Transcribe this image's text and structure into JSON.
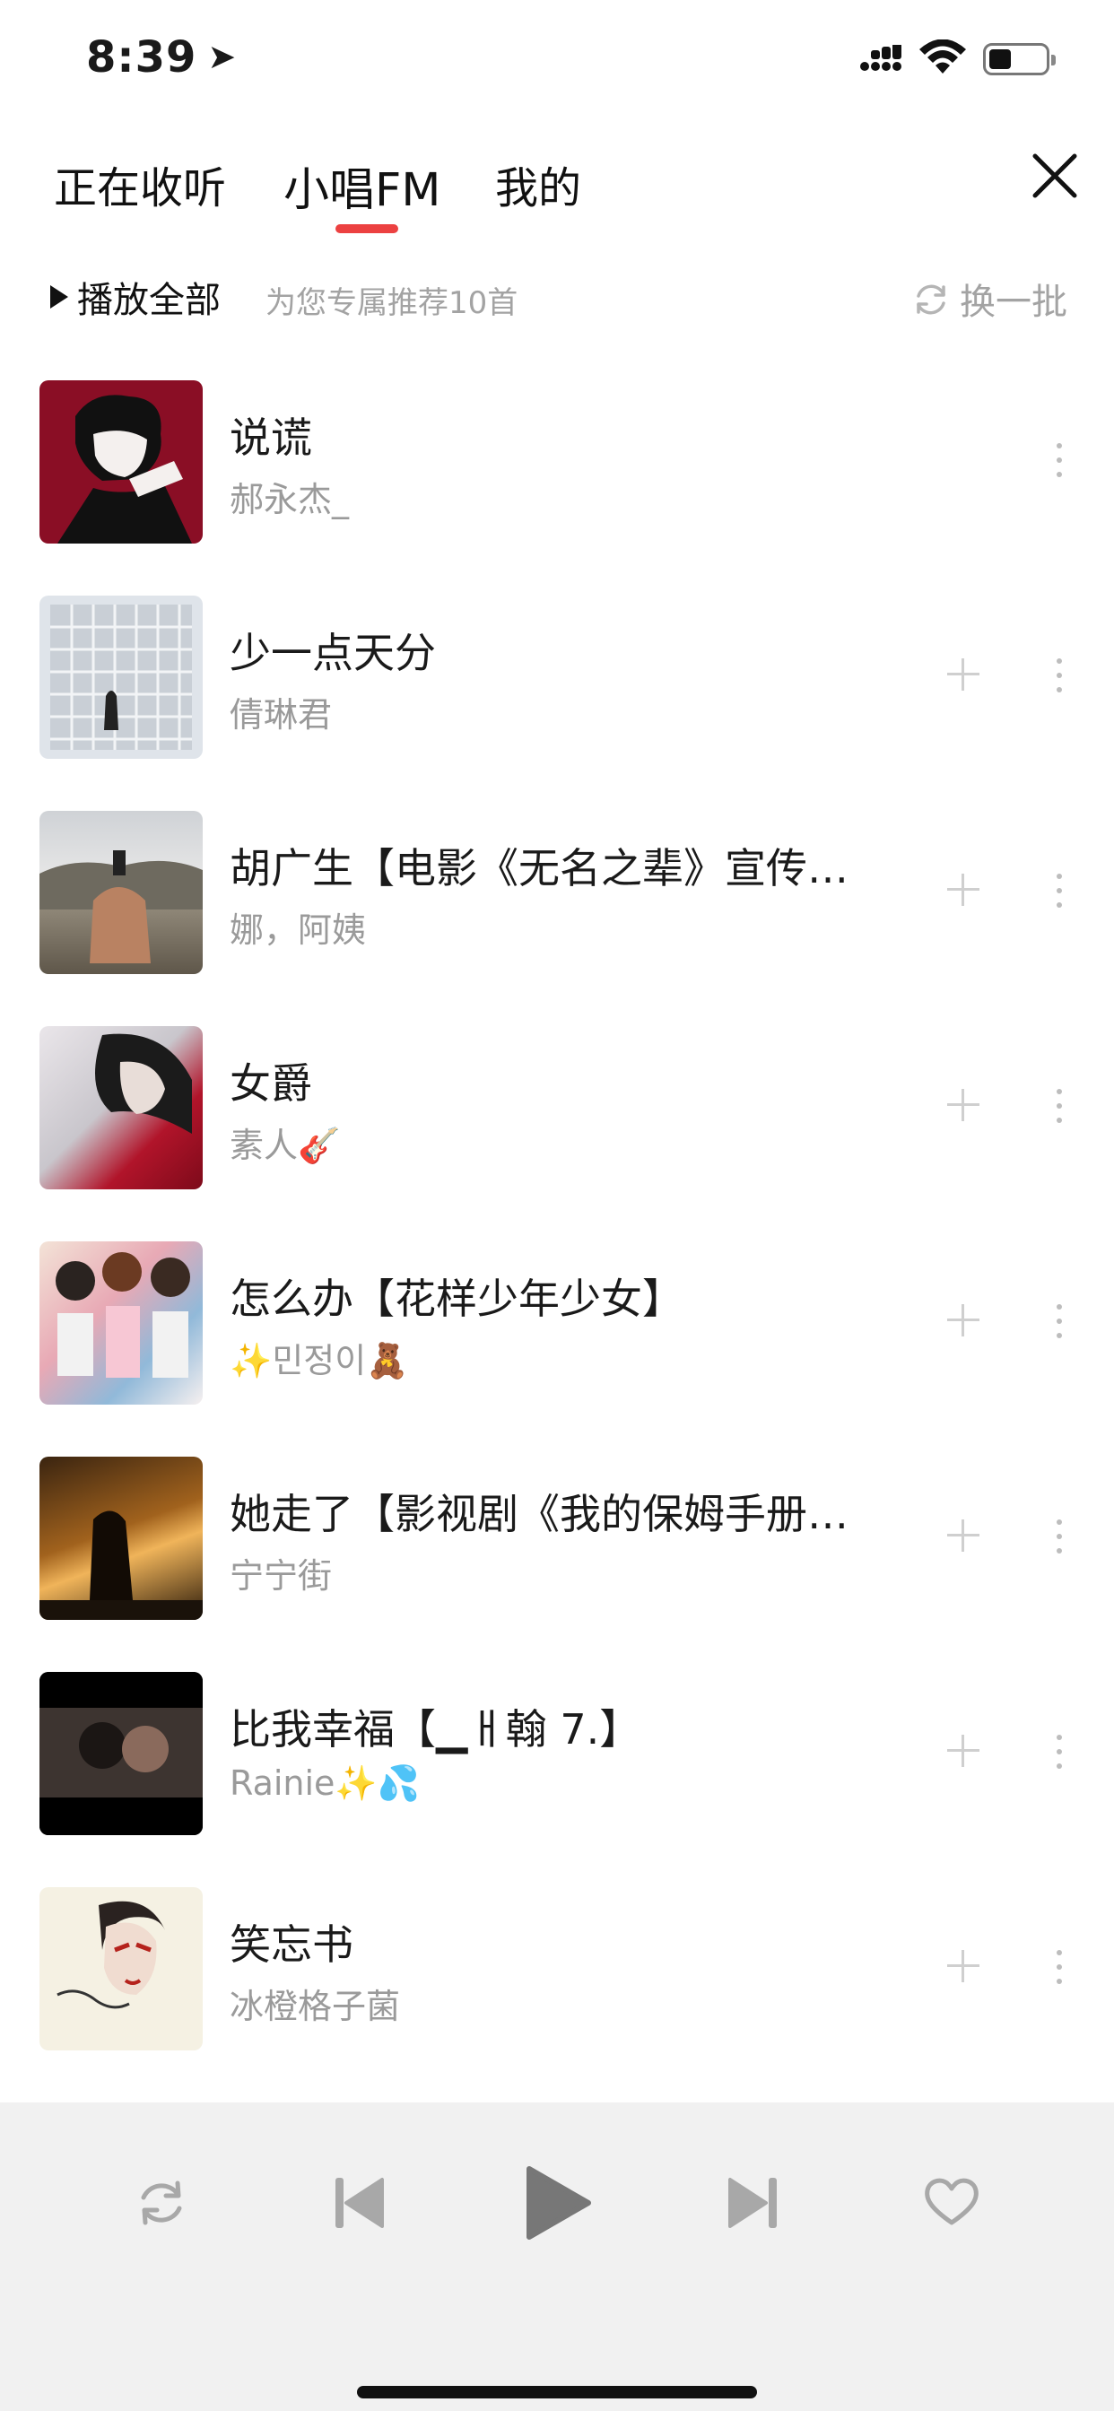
{
  "status_bar": {
    "time": "8:39"
  },
  "tabs": [
    {
      "label": "正在收听"
    },
    {
      "label": "小唱FM"
    },
    {
      "label": "我的"
    }
  ],
  "actions": {
    "play_all": "播放全部",
    "recommend_note": "为您专属推荐10首",
    "refresh": "换一批"
  },
  "songs": [
    {
      "title": "说谎",
      "artist": "郝永杰_"
    },
    {
      "title": "少一点天分",
      "artist": "倩琳君"
    },
    {
      "title": "胡广生【电影《无名之辈》宣传…",
      "artist": "娜，阿姨"
    },
    {
      "title": "女爵",
      "artist": "素人🎸"
    },
    {
      "title": "怎么办【花样少年少女】",
      "artist": "✨민정이🧸"
    },
    {
      "title": "她走了【影视剧《我的保姆手册…",
      "artist": "宁宁街"
    },
    {
      "title": "比我幸福【▁ㅐ翰 7.】",
      "artist": "Rainie✨💦"
    },
    {
      "title": "笑忘书",
      "artist": "冰橙格子菌"
    }
  ],
  "colors": {
    "accent": "#ec4141",
    "secondary_text": "#9a9a9a",
    "player_bg": "#f1f1f1"
  }
}
